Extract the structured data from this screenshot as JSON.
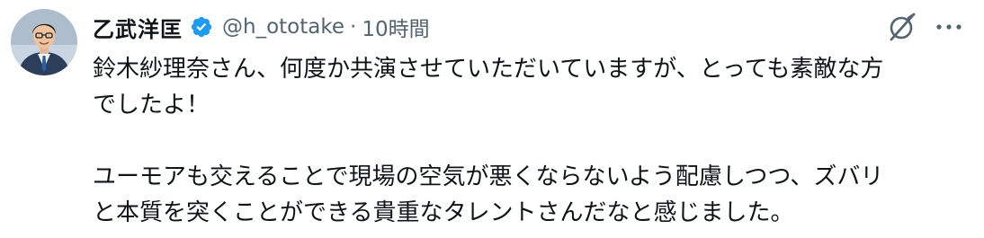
{
  "tweet": {
    "author_name": "乙武洋匡",
    "handle": "@h_ototake",
    "separator": "·",
    "time": "10時間",
    "paragraph1_line1": "鈴木紗理奈さん、何度か共演させていただいていますが、とっても素敵な方",
    "paragraph1_line2": "でしたよ！",
    "paragraph2_line1": "ユーモアも交えることで現場の空気が悪くならないよう配慮しつつ、ズバリ",
    "paragraph2_line2": "と本質を突くことができる貴重なタレントさんだなと感じました。"
  },
  "icons": {
    "verified": "verified-badge-icon",
    "grok": "grok-icon",
    "more": "more-icon"
  },
  "colors": {
    "text": "#0f1419",
    "secondary": "#536471",
    "verified": "#1d9bf0"
  }
}
